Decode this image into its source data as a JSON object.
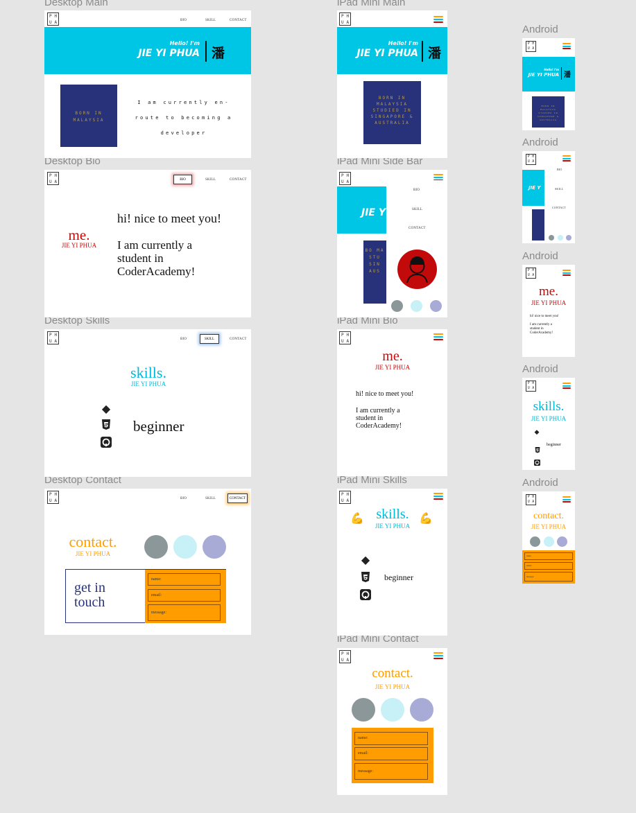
{
  "colors": {
    "accent": "#00c6e6",
    "navy": "#27327a",
    "red": "#c20a0a",
    "orange": "#ff9d00",
    "grey_circle": "#8b9799",
    "light_circle": "#c8f0f7",
    "lavender_circle": "#a7abd6",
    "ham_1": "#ff9d00",
    "ham_2": "#00c6e6",
    "ham_3": "#c20a0a"
  },
  "logo": [
    "P",
    "H",
    "U",
    "A"
  ],
  "nav": {
    "bio": "BIO",
    "skill": "SKILL",
    "contact": "CONTACT"
  },
  "hero": {
    "hello": "Hello! I'm",
    "name": "JIE YI PHUA",
    "han": "潘",
    "name_short": "JIE Y"
  },
  "born": {
    "desktop": "BORN IN MALAYSIA",
    "tablet": "BORN IN MALAYSIA STUDIED IN SINGAPORE & AUSTRALIA",
    "sidebar": "BO MA STU SIN AUS",
    "phone": "BORN IN MALAYSIA STUDIED IN SINGAPORE & AUSTRALIA"
  },
  "intro": "I am currently en-route to becoming a developer",
  "bio": {
    "me": "me.",
    "name": "JIE YI PHUA",
    "greeting": "hi! nice to meet you!",
    "student": "I am currently a student in CoderAcademy!"
  },
  "skills": {
    "title": "skills.",
    "name": "JIE YI PHUA",
    "level": "beginner",
    "icons": [
      "gem-icon",
      "css3-icon",
      "github-icon"
    ]
  },
  "contact": {
    "title": "contact.",
    "name": "JIE YI PHUA",
    "get_in_touch": "get in touch",
    "fields": [
      "name:",
      "email:",
      "message:"
    ]
  },
  "frames": {
    "desktop_main": "Desktop Main",
    "desktop_bio": "Desktop Bio",
    "desktop_skills": "Desktop Skills",
    "desktop_contact": "Desktop Contact",
    "ipad_main": "iPad Mini Main",
    "ipad_sidebar": "iPad Mini Side Bar",
    "ipad_bio": "iPad Mini Bio",
    "ipad_skills": "iPad Mini Skills",
    "ipad_contact": "iPad Mini Contact",
    "android_1": "Android",
    "android_2": "Android",
    "android_3": "Android",
    "android_4": "Android",
    "android_5": "Android"
  }
}
